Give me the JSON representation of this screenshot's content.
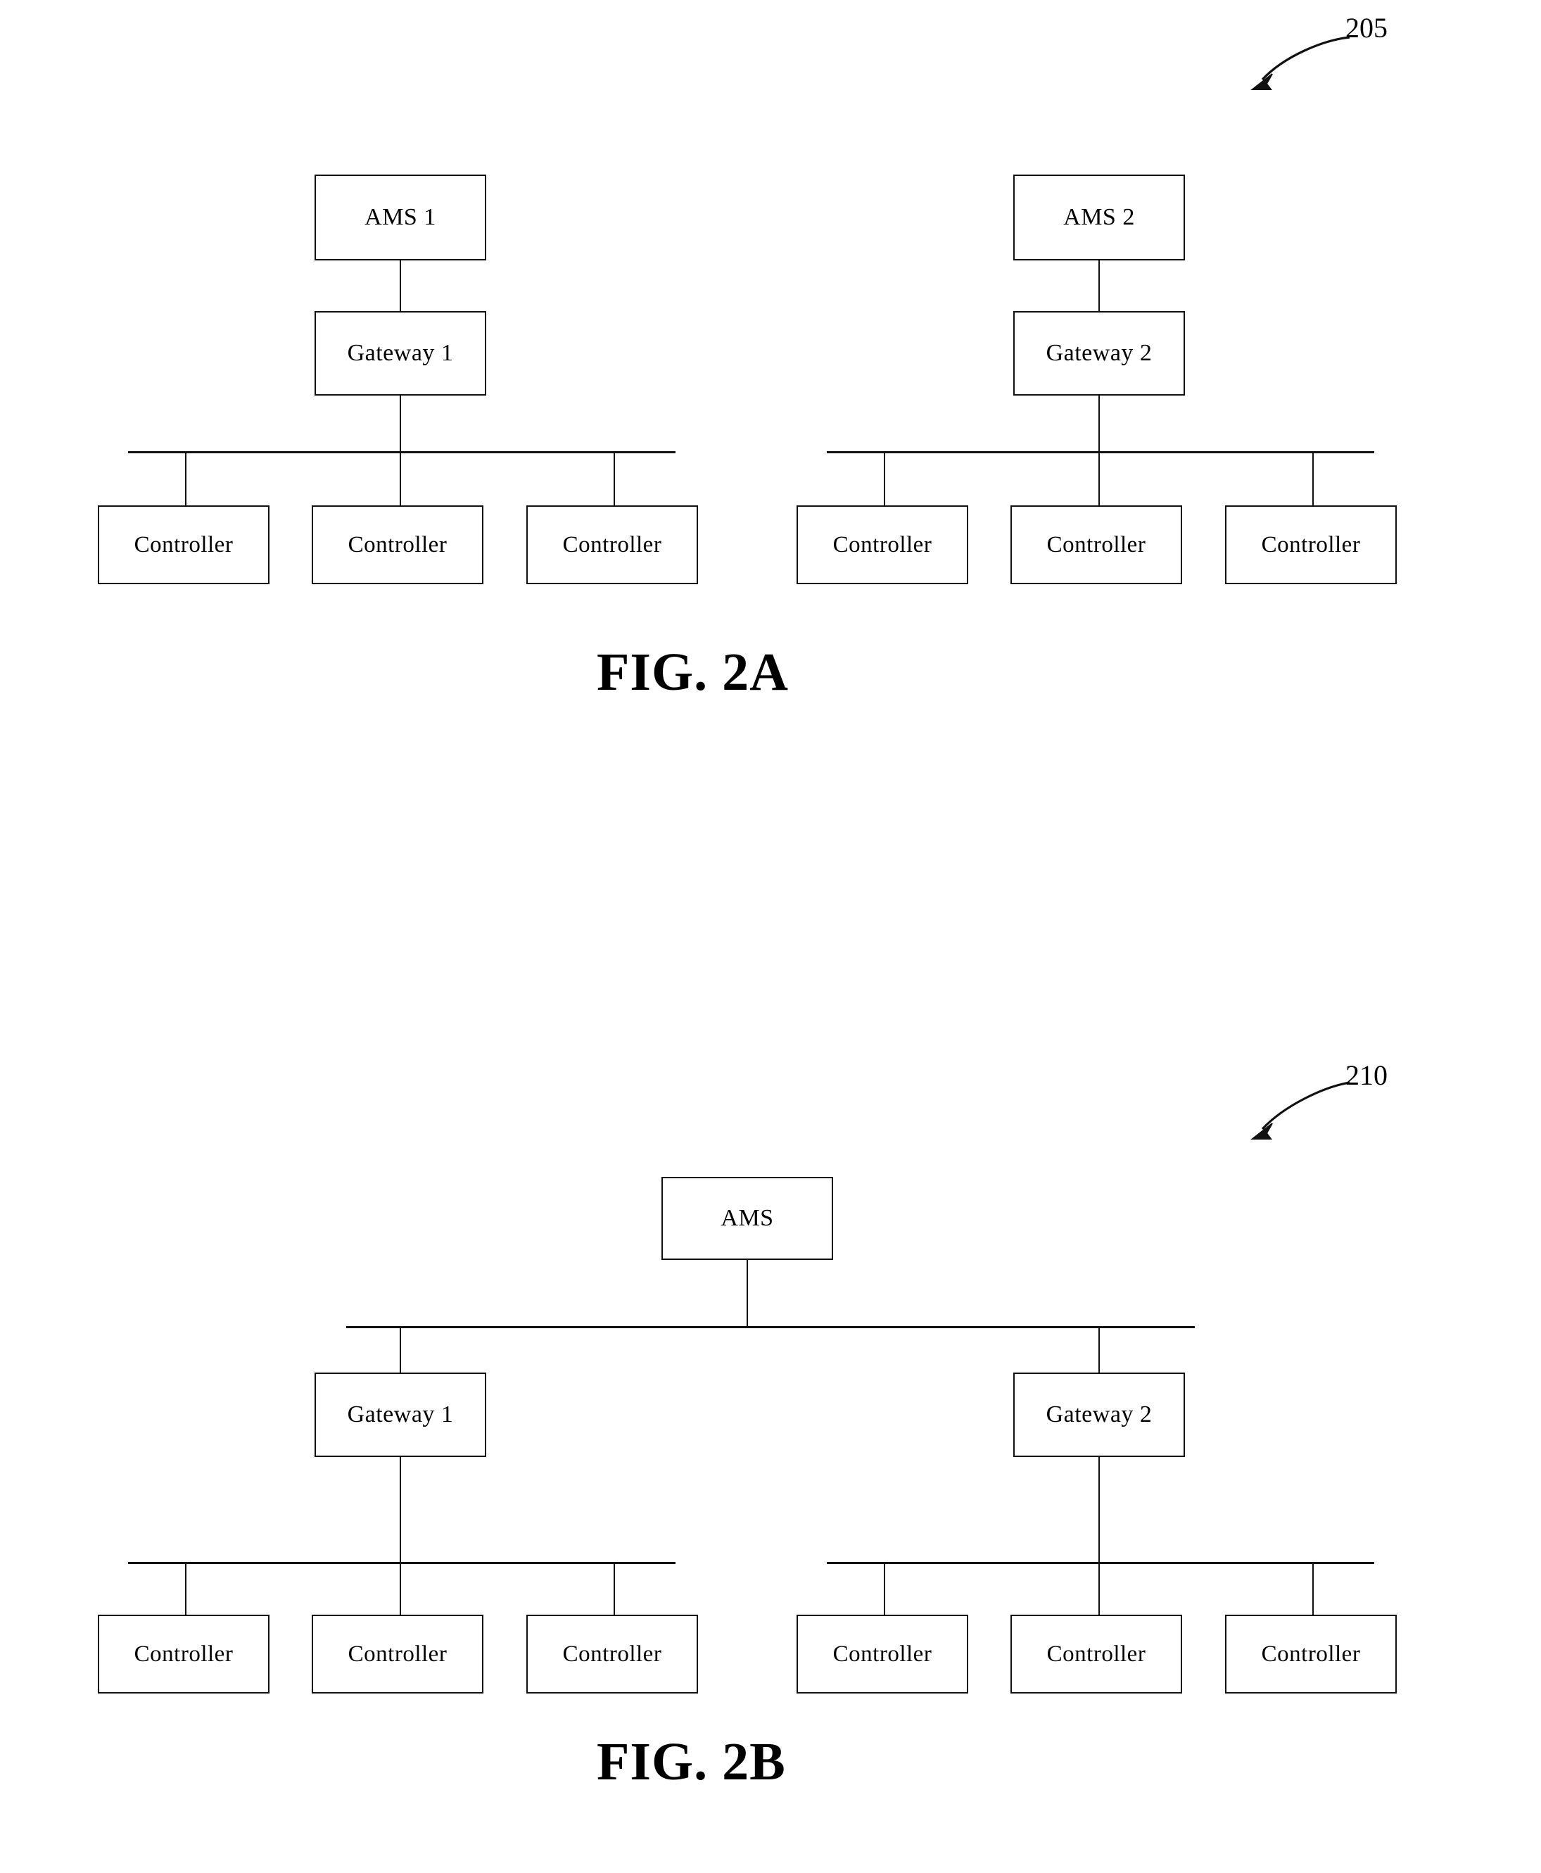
{
  "document": {
    "kind": "patent-drawing-sheet",
    "background_color": "#ffffff",
    "line_color": "#111111"
  },
  "figures": [
    {
      "id": "fig-2a",
      "caption": "FIG. 2A",
      "reference_numeral": "205",
      "description": "Two independent AMS/Gateway hierarchies, each gateway bussed to three controllers",
      "clusters": [
        {
          "id": "cluster-left",
          "ams": {
            "label": "AMS 1"
          },
          "gateway": {
            "label": "Gateway  1"
          },
          "controllers": [
            {
              "label": "Controller"
            },
            {
              "label": "Controller"
            },
            {
              "label": "Controller"
            }
          ]
        },
        {
          "id": "cluster-right",
          "ams": {
            "label": "AMS 2"
          },
          "gateway": {
            "label": "Gateway  2"
          },
          "controllers": [
            {
              "label": "Controller"
            },
            {
              "label": "Controller"
            },
            {
              "label": "Controller"
            }
          ]
        }
      ]
    },
    {
      "id": "fig-2b",
      "caption": "FIG. 2B",
      "reference_numeral": "210",
      "description": "Single AMS bussed to two gateways, each gateway bussed to three controllers",
      "ams": {
        "label": "AMS"
      },
      "clusters": [
        {
          "id": "cluster-left",
          "gateway": {
            "label": "Gateway  1"
          },
          "controllers": [
            {
              "label": "Controller"
            },
            {
              "label": "Controller"
            },
            {
              "label": "Controller"
            }
          ]
        },
        {
          "id": "cluster-right",
          "gateway": {
            "label": "Gateway  2"
          },
          "controllers": [
            {
              "label": "Controller"
            },
            {
              "label": "Controller"
            },
            {
              "label": "Controller"
            }
          ]
        }
      ]
    }
  ]
}
